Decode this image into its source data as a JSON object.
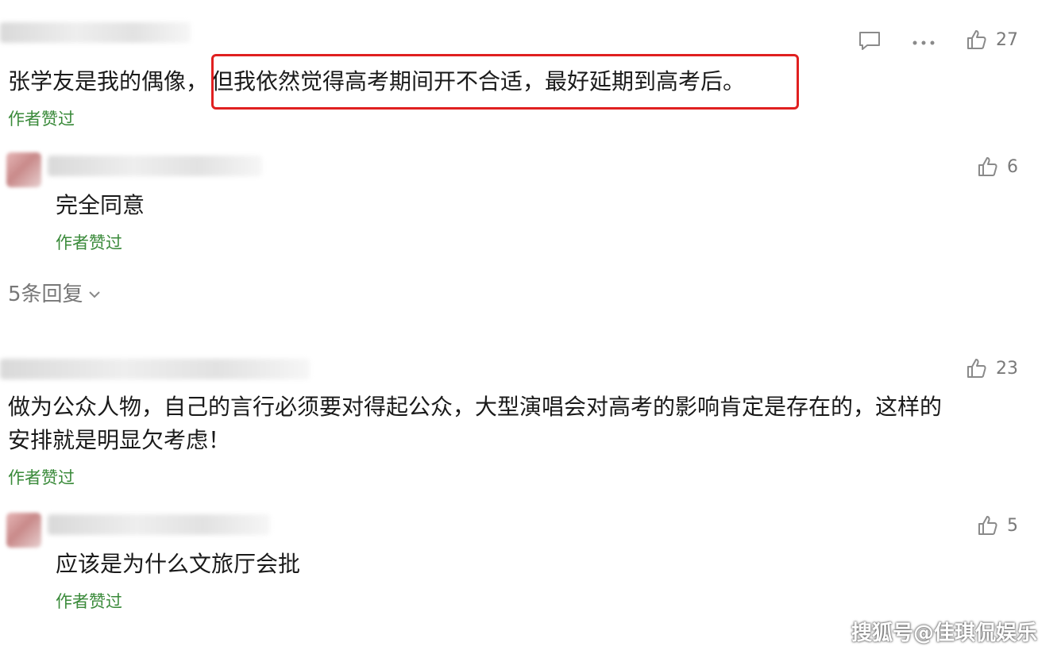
{
  "comments": [
    {
      "text_plain": "张学友是我的偶像，",
      "text_highlight": "但我依然觉得高考期间开不合适，最好延期到高考后。",
      "liked_label": "作者赞过",
      "likes": "27"
    },
    {
      "text": "完全同意",
      "liked_label": "作者赞过",
      "likes": "6"
    },
    {
      "text_line1": "做为公众人物，自己的言行必须要对得起公众，大型演唱会对高考的影响肯定是存在的，这样的",
      "text_line2": "安排就是明显欠考虑！",
      "liked_label": "作者赞过",
      "likes": "23"
    },
    {
      "text": "应该是为什么文旅厅会批",
      "liked_label": "作者赞过",
      "likes": "5"
    }
  ],
  "replies_label": "5条回复",
  "watermark": "搜狐号@佳琪侃娱乐",
  "icons": [
    "comment-icon",
    "more-icon",
    "thumbs-up-icon",
    "chevron-down-icon"
  ],
  "colors": {
    "liked_green": "#3a8a3a",
    "highlight_red": "#e02020"
  }
}
